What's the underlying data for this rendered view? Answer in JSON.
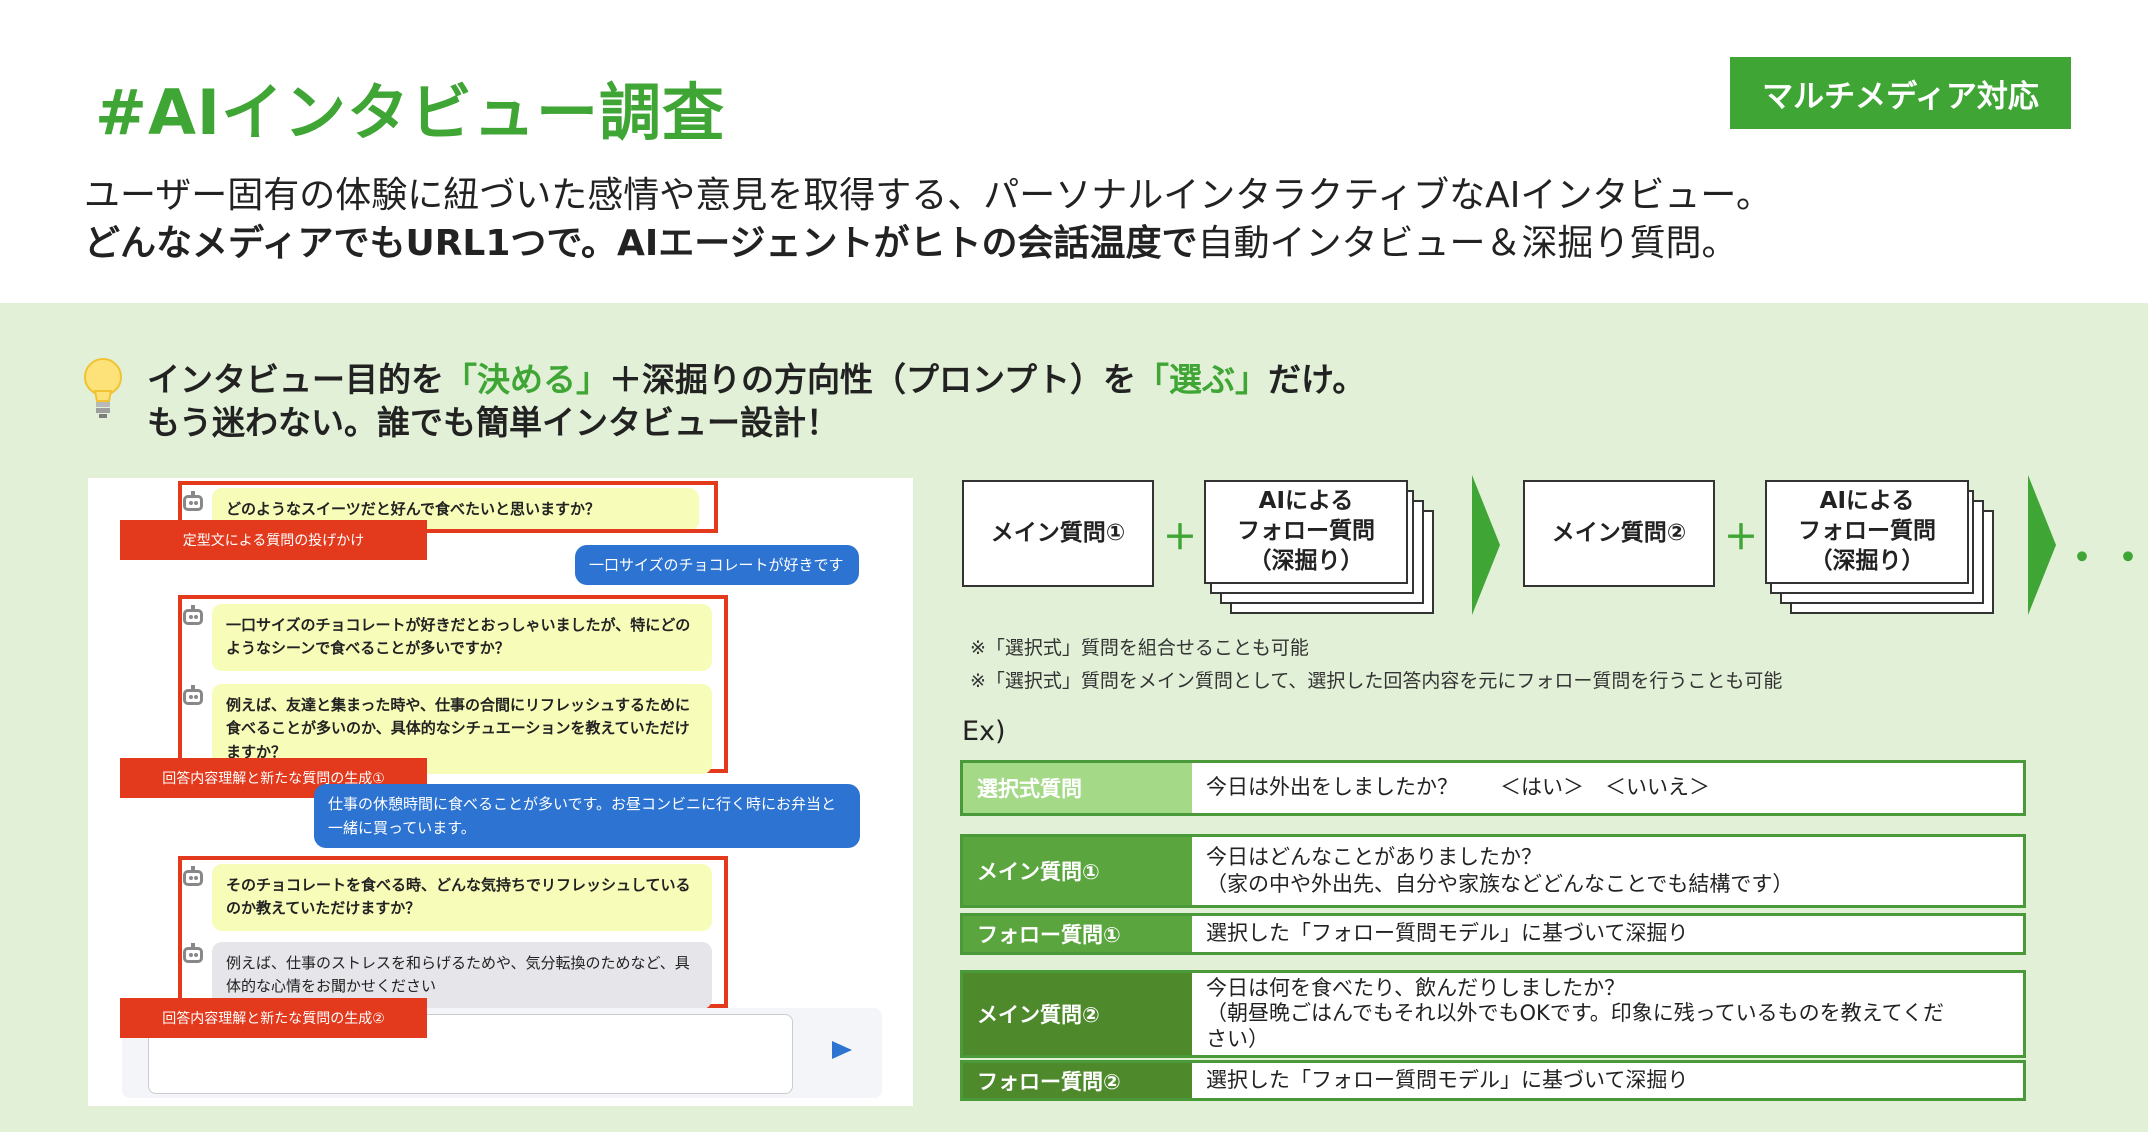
{
  "header": {
    "title": "#AIインタビュー調査",
    "badge": "マルチメディア対応",
    "lead_line1": "ユーザー固有の体験に紐づいた感情や意見を取得する、パーソナルインタラクティブなAIインタビュー。",
    "lead_line2_bold": "どんなメディアでもURL1つで。AIエージェントがヒトの会話温度で",
    "lead_line2_rest": "自動インタビュー＆深掘り質問。"
  },
  "panel": {
    "heading1_a": "インタビュー目的を",
    "heading1_b": "「決める」",
    "heading1_c": "＋深掘りの方向性（プロンプト）を",
    "heading1_d": "「選ぶ」",
    "heading1_e": "だけ。",
    "heading2": "もう迷わない。誰でも簡単インタビュー設計！"
  },
  "chat": {
    "q1": "どのようなスイーツだと好んで食べたいと思いますか？",
    "label1": "定型文による質問の投げかけ",
    "u1": "一口サイズのチョコレートが好きです",
    "q2_line1": "一口サイズのチョコレートが好きだとおっしゃいましたが、特にどの",
    "q2_line2": "ようなシーンで食べることが多いですか？",
    "q3_line1": "例えば、友達と集まった時や、仕事の合間にリフレッシュするために",
    "q3_line2": "食べることが多いのか、具体的なシチュエーションを教えていただけ",
    "q3_line3": "ますか？",
    "label2": "回答内容理解と新たな質問の生成①",
    "u2_line1": "仕事の休憩時間に食べることが多いです。お昼コンビニに行く時にお弁当と",
    "u2_line2": "一緒に買っています。",
    "q4_line1": "そのチョコレートを食べる時、どんな気持ちでリフレッシュしている",
    "q4_line2": "のか教えていただけますか？",
    "q5_line1": "例えば、仕事のストレスを和らげるためや、気分転換のためなど、具",
    "q5_line2": "体的な心情をお聞かせください",
    "label3": "回答内容理解と新たな質問の生成②",
    "send_icon": "send-icon"
  },
  "flow": {
    "main1": "メイン質問①",
    "follow1_l1": "AIによる",
    "follow1_l2": "フォロー質問",
    "follow1_l3": "（深掘り）",
    "main2": "メイン質問②",
    "follow2_l1": "AIによる",
    "follow2_l2": "フォロー質問",
    "follow2_l3": "（深掘り）",
    "plus": "＋",
    "dots": "・・・",
    "note1": "※「選択式」質問を組合せることも可能",
    "note2": "※「選択式」質問をメイン質問として、選択した回答内容を元にフォロー質問を行うことも可能"
  },
  "examples": {
    "ex_label": "Ex)",
    "rows": [
      {
        "label": "選択式質問",
        "lines": [
          "今日は外出をしましたか？　　＜はい＞　＜いいえ＞"
        ]
      },
      {
        "label": "メイン質問①",
        "lines": [
          "今日はどんなことがありましたか？",
          "（家の中や外出先、自分や家族などどんなことでも結構です）"
        ]
      },
      {
        "label": "フォロー質問①",
        "lines": [
          "選択した「フォロー質問モデル」に基づいて深掘り"
        ]
      },
      {
        "label": "メイン質問②",
        "lines": [
          "今日は何を食べたり、飲んだりしましたか？",
          "（朝昼晩ごはんでもそれ以外でもOKです。印象に残っているものを教えてくだ",
          "さい）"
        ]
      },
      {
        "label": "フォロー質問②",
        "lines": [
          "選択した「フォロー質問モデル」に基づいて深掘り"
        ]
      }
    ]
  },
  "colors": {
    "accent_green": "#3fa535",
    "panel_bg": "#e1f0d7",
    "highlight_red": "#e33a1e",
    "user_bubble_blue": "#2c73d2"
  }
}
